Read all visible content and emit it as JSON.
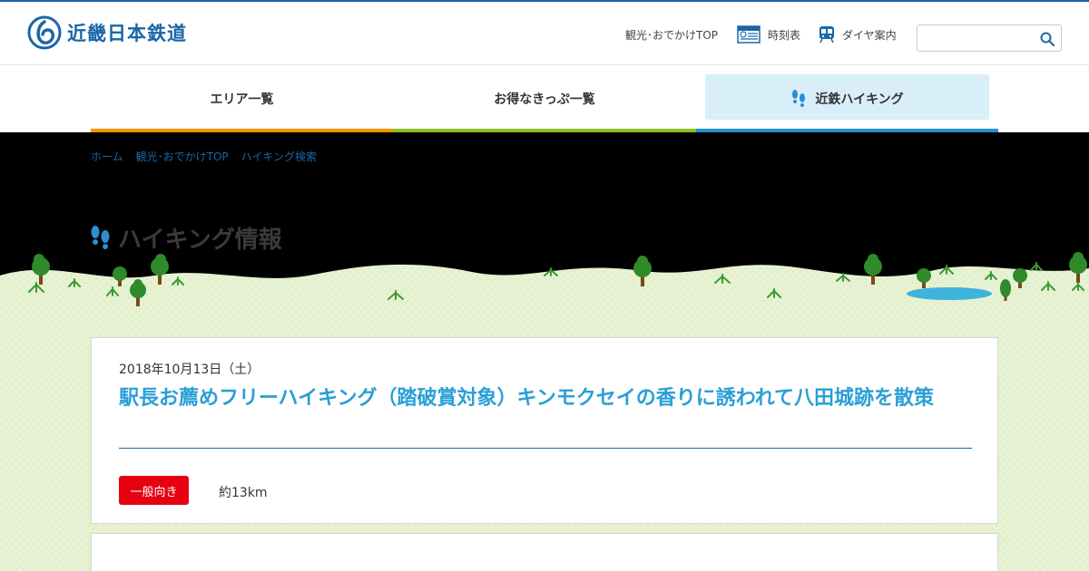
{
  "header": {
    "logo_text": "近畿日本鉄道",
    "nav": [
      {
        "label": "観光･おでかけTOP",
        "icon": "none"
      },
      {
        "label": "時刻表",
        "icon": "timetable-icon"
      },
      {
        "label": "ダイヤ案内",
        "icon": "train-icon"
      }
    ],
    "search": {
      "placeholder": ""
    }
  },
  "global_nav": [
    {
      "label": "エリア一覧",
      "accent": "#f39800"
    },
    {
      "label": "お得なきっぷ一覧",
      "accent": "#8dc21f"
    },
    {
      "label": "近鉄ハイキング",
      "accent": "#2a8fd0",
      "active": true
    }
  ],
  "breadcrumb": [
    "ホーム",
    "観光･おでかけTOP",
    "ハイキング検索"
  ],
  "page_title": "ハイキング情報",
  "event": {
    "date": "2018年10月13日（土）",
    "title": "駅長お薦めフリーハイキング（踏破賞対象）キンモクセイの香りに誘われて八田城跡を散策",
    "level": "一般向き",
    "distance": "約13km"
  },
  "colors": {
    "brand": "#1b66a8",
    "title": "#2a9fd6",
    "level_badge": "#e60012",
    "grass": "#e6f2d2"
  }
}
